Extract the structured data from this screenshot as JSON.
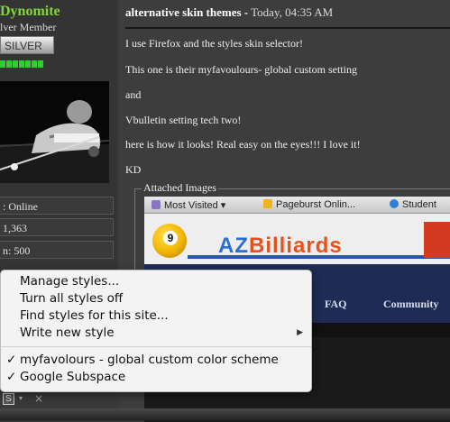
{
  "user": {
    "name": "Dynomite",
    "title": "lver Member",
    "rank": "SILVER",
    "stats": [
      ": Online",
      "1,363",
      "n: 500"
    ]
  },
  "post": {
    "title": "alternative skin themes -",
    "date": "Today, 04:35 AM",
    "lines": [
      "I use Firefox and the styles skin selector!",
      "This one is their myfavoulours- global custom setting",
      "and",
      "Vbulletin setting tech two!",
      "here is how it looks! Real easy on the eyes!!! I love it!",
      "KD"
    ],
    "attached_label": "Attached Images"
  },
  "attached_screenshot": {
    "bookmarks": [
      "Most Visited",
      "Pageburst Onlin...",
      "Student"
    ],
    "logo_az": "AZ",
    "logo_rest": "Billiards",
    "ball_number": "9",
    "nav": [
      "FAQ",
      "Community"
    ]
  },
  "context_menu": {
    "items": [
      {
        "label": "Manage styles...",
        "checked": false,
        "submenu": false
      },
      {
        "label": "Turn all styles off",
        "checked": false,
        "submenu": false
      },
      {
        "label": "Find styles for this site...",
        "checked": false,
        "submenu": false
      },
      {
        "label": "Write new style",
        "checked": false,
        "submenu": true
      },
      {
        "label": "myfavolours - global custom color scheme",
        "checked": true,
        "submenu": false
      },
      {
        "label": "Google Subspace",
        "checked": true,
        "submenu": false
      }
    ]
  },
  "status_bar": {
    "stylish_letter": "S",
    "dropdown": "▾",
    "close": "×"
  },
  "colors": {
    "username": "#7dd63a",
    "reputation": "#2ed02e",
    "page_bg": "#3d3d3d"
  }
}
